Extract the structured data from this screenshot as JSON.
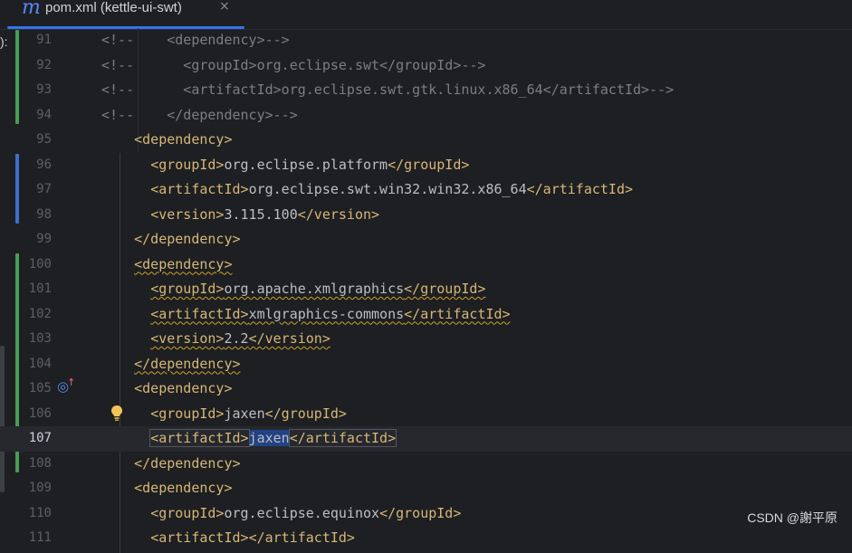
{
  "tab": {
    "icon": "maven-m-icon",
    "icon_glyph": "m",
    "title": "pom.xml (kettle-ui-swt)",
    "close_glyph": "×"
  },
  "left_peek": "):",
  "lines": [
    {
      "num": "91",
      "indent": "",
      "kind": "comment",
      "text": "<!--    <dependency>-->"
    },
    {
      "num": "92",
      "indent": "",
      "kind": "comment",
      "text": "<!--      <groupId>org.eclipse.swt</groupId>-->"
    },
    {
      "num": "93",
      "indent": "",
      "kind": "comment",
      "text": "<!--      <artifactId>org.eclipse.swt.gtk.linux.x86_64</artifactId>-->"
    },
    {
      "num": "94",
      "indent": "",
      "kind": "comment",
      "text": "<!--    </dependency>-->"
    },
    {
      "num": "95",
      "indent": "    ",
      "kind": "open",
      "tag": "<dependency>"
    },
    {
      "num": "96",
      "indent": "      ",
      "kind": "elem",
      "open": "<groupId>",
      "value": "org.eclipse.platform",
      "close": "</groupId>"
    },
    {
      "num": "97",
      "indent": "      ",
      "kind": "elem",
      "open": "<artifactId>",
      "value": "org.eclipse.swt.win32.win32.x86_64",
      "close": "</artifactId>"
    },
    {
      "num": "98",
      "indent": "      ",
      "kind": "elem",
      "open": "<version>",
      "value": "3.115.100",
      "close": "</version>"
    },
    {
      "num": "99",
      "indent": "    ",
      "kind": "open",
      "tag": "</dependency>"
    },
    {
      "num": "100",
      "indent": "    ",
      "kind": "open",
      "tag": "<dependency>",
      "warn": true
    },
    {
      "num": "101",
      "indent": "      ",
      "kind": "elem",
      "open": "<groupId>",
      "value": "org.apache.xmlgraphics",
      "close": "</groupId>",
      "warn": true
    },
    {
      "num": "102",
      "indent": "      ",
      "kind": "elem",
      "open": "<artifactId>",
      "value": "xmlgraphics-commons",
      "close": "</artifactId>",
      "warn": true
    },
    {
      "num": "103",
      "indent": "      ",
      "kind": "elem",
      "open": "<version>",
      "value": "2.2",
      "close": "</version>",
      "warn": true
    },
    {
      "num": "104",
      "indent": "    ",
      "kind": "open",
      "tag": "</dependency>",
      "warn": true
    },
    {
      "num": "105",
      "indent": "    ",
      "kind": "open",
      "tag": "<dependency>"
    },
    {
      "num": "106",
      "indent": "      ",
      "kind": "elem",
      "open": "<groupId>",
      "value": "jaxen",
      "close": "</groupId>"
    },
    {
      "num": "107",
      "indent": "      ",
      "kind": "elem",
      "open": "<artifactId>",
      "value": "jaxen",
      "close": "</artifactId>",
      "current": true
    },
    {
      "num": "108",
      "indent": "    ",
      "kind": "open",
      "tag": "</dependency>"
    },
    {
      "num": "109",
      "indent": "    ",
      "kind": "open",
      "tag": "<dependency>"
    },
    {
      "num": "110",
      "indent": "      ",
      "kind": "elem",
      "open": "<groupId>",
      "value": "org.eclipse.equinox",
      "close": "</groupId>"
    },
    {
      "num": "111",
      "indent": "      ",
      "kind": "elem",
      "open": "<artifactId>",
      "value": "",
      "close": "</artifactId>"
    }
  ],
  "gutter_icons": {
    "implementation": "implemented-overriding-icon",
    "intention": "lightbulb-icon"
  },
  "colors": {
    "background": "#1e1f22",
    "tag": "#d5b778",
    "text": "#bcbec4",
    "comment": "#7a7e85",
    "line_number": "#5b5f66",
    "change_added": "#499c54",
    "change_modified": "#3b6fcf",
    "selection": "#214283",
    "warning_underline": "#c9a226",
    "tab_accent": "#3574f0"
  },
  "watermark": "CSDN @謝平原"
}
